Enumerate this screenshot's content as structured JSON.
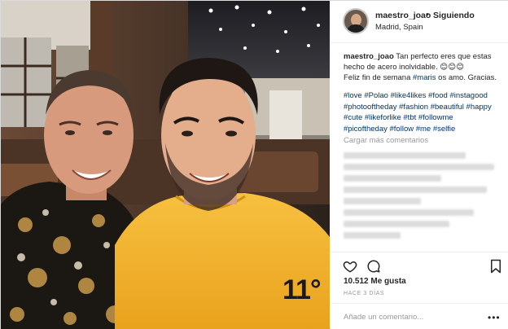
{
  "post": {
    "username": "maestro_joao",
    "separator": "•",
    "follow_status": "Siguiendo",
    "location": "Madrid, Spain"
  },
  "caption": {
    "username": "maestro_joao",
    "line1": "Tan perfecto eres que estas",
    "line2": "hecho de acero inolvidable. 😊😊😊",
    "line3_a": "Feliz fin de semana ",
    "line3_tag": "#maris",
    "line3_b": " os amo. Gracias."
  },
  "hashtags": [
    "#love #Polao #like4likes #food #instagood",
    "#photooftheday #fashion #beautiful #happy",
    "#cute #likeforlike #tbt #followme",
    "#picoftheday #follow #me #selfie"
  ],
  "load_more": "Cargar más comentarios",
  "likes": "10.512 Me gusta",
  "timestamp": "HACE 3 DÍAS",
  "comment_placeholder": "Añade un comentario...",
  "jersey_number": "11°",
  "colors": {
    "link": "#003569",
    "muted": "#999999",
    "text": "#262626",
    "shirt": "#f6b832"
  },
  "icons": [
    "heart-icon",
    "comment-icon",
    "bookmark-icon",
    "more-options-icon"
  ]
}
